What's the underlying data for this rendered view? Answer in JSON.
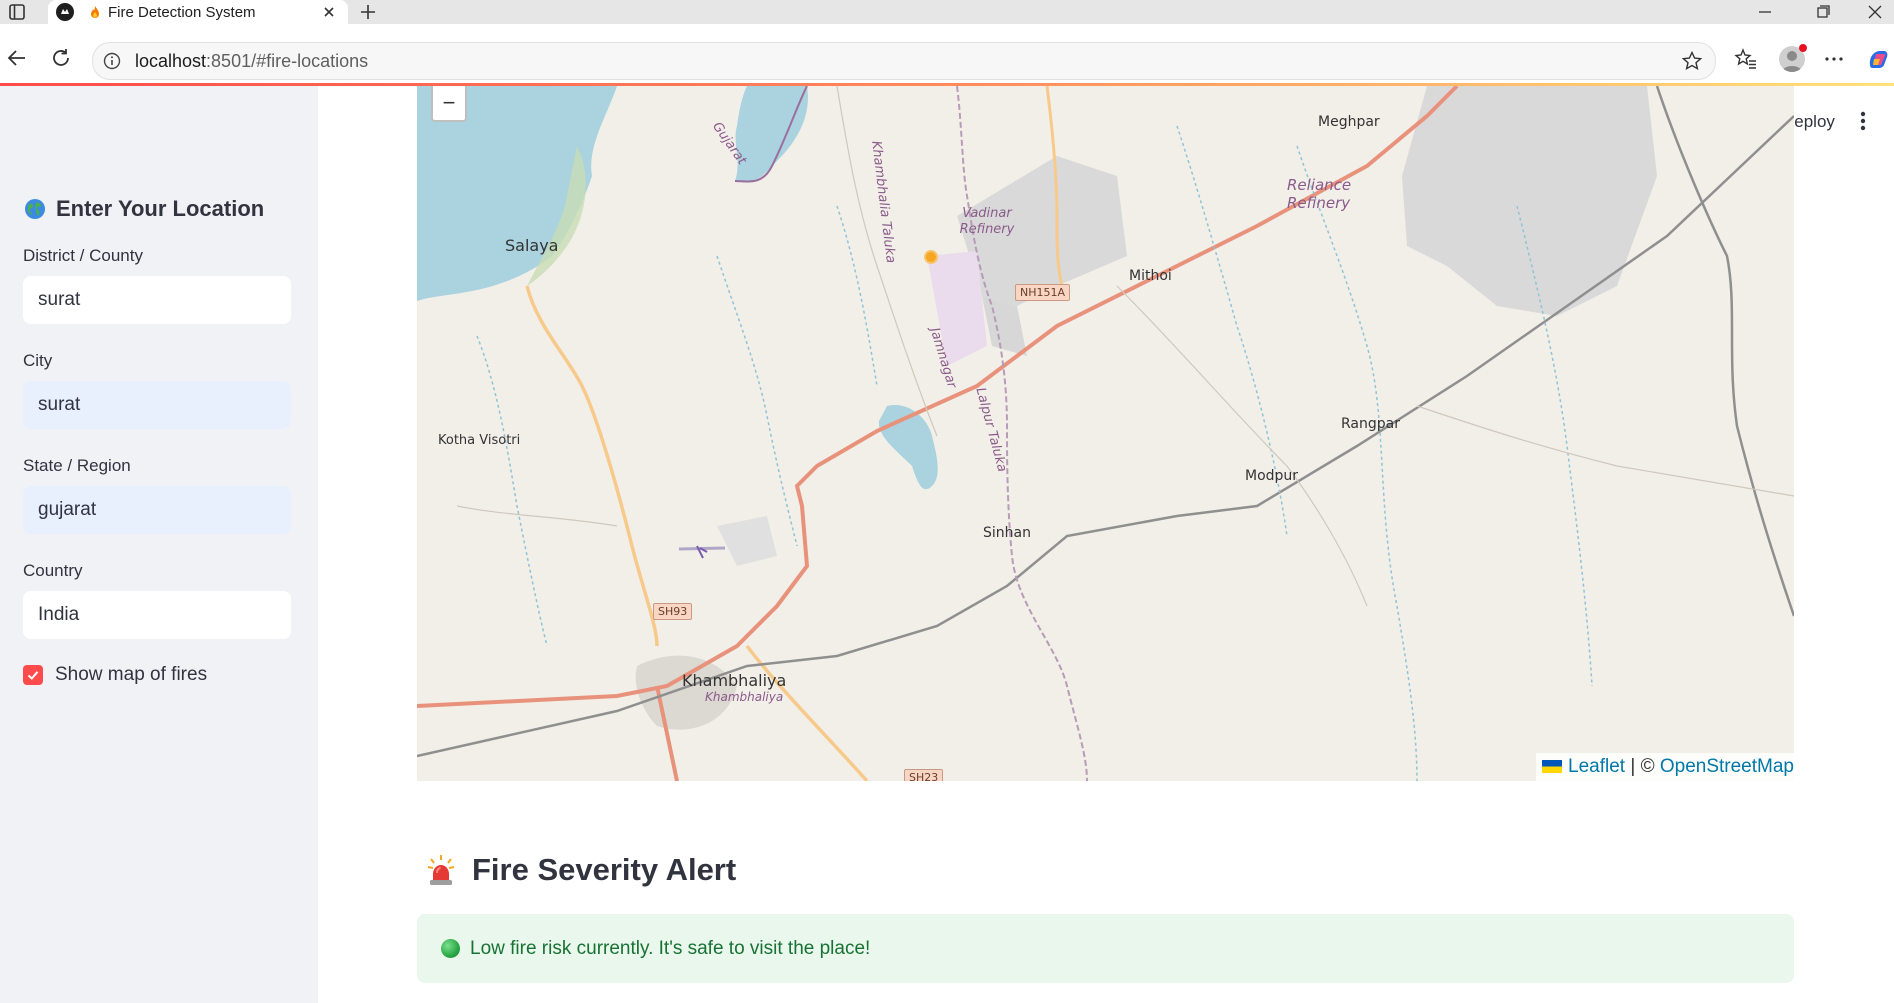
{
  "browser": {
    "tab_title": "Fire Detection System",
    "url_host": "localhost",
    "url_rest": ":8501/#fire-locations",
    "icons": [
      "sidebar-toggle-icon",
      "flame-favicon-icon",
      "tab-close-icon",
      "new-tab-icon",
      "minimize-icon",
      "maximize-icon",
      "close-window-icon",
      "back-icon",
      "reload-icon",
      "site-info-icon",
      "bookmark-star-icon",
      "favorites-icon",
      "more-icon",
      "copilot-icon"
    ]
  },
  "header": {
    "deploy_label": "Deploy"
  },
  "sidebar": {
    "heading": "Enter Your Location",
    "fields": [
      {
        "label": "District / County",
        "value": "surat"
      },
      {
        "label": "City",
        "value": "surat"
      },
      {
        "label": "State / Region",
        "value": "gujarat"
      },
      {
        "label": "Country",
        "value": "India"
      }
    ],
    "checkbox": {
      "label": "Show map of fires",
      "checked": true
    }
  },
  "map": {
    "zoom_out_label": "−",
    "labels": {
      "salaya": "Salaya",
      "gujarat": "Gujarat",
      "khambhalia_taluka": "Khambhalia Taluka",
      "vadinar_refinery": "Vadinar Refinery",
      "meghpar": "Meghpar",
      "reliance_refinery": "Reliance Refinery",
      "mithoi": "Mithoi",
      "nh151a": "NH151A",
      "jamnagar": "Jamnagar",
      "lalpur_taluka": "Lalpur Taluka",
      "kotha_visotri": "Kotha Visotri",
      "rangpar": "Rangpar",
      "modpur": "Modpur",
      "sinhan": "Sinhan",
      "sh93": "SH93",
      "khambhaliya": "Khambhaliya",
      "khambhaliya_sub": "Khambhaliya",
      "sh23": "SH23"
    },
    "attribution": {
      "leaflet": "Leaflet",
      "separator": " | © ",
      "osm": "OpenStreetMap"
    },
    "colors": {
      "water": "#aad3df",
      "land": "#f2efe9",
      "primary_road": "#e8927c",
      "secondary_road": "#f7c98a",
      "marker": "#f5a623"
    }
  },
  "alert": {
    "title": "Fire Severity Alert",
    "message": "Low fire risk currently. It's safe to visit the place!",
    "colors": {
      "background": "#e9f7ec",
      "text": "#177233"
    }
  }
}
